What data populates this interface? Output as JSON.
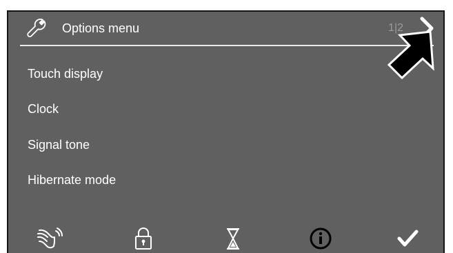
{
  "header": {
    "title": "Options menu",
    "page_indicator": "1|2",
    "icon": "wrench-icon",
    "next_icon": "chevron-right-icon"
  },
  "menu": {
    "items": [
      {
        "label": "Touch display"
      },
      {
        "label": "Clock"
      },
      {
        "label": "Signal tone"
      },
      {
        "label": "Hibernate mode"
      }
    ]
  },
  "footer": {
    "icons": [
      "cleaning-hand-icon",
      "lock-icon",
      "hourglass-icon",
      "info-icon",
      "checkmark-icon"
    ]
  },
  "colors": {
    "screen_background": "#606060",
    "text": "#ffffff",
    "page_indicator": "#9c9c9c",
    "divider": "#ececec",
    "pointer": "#000000"
  }
}
